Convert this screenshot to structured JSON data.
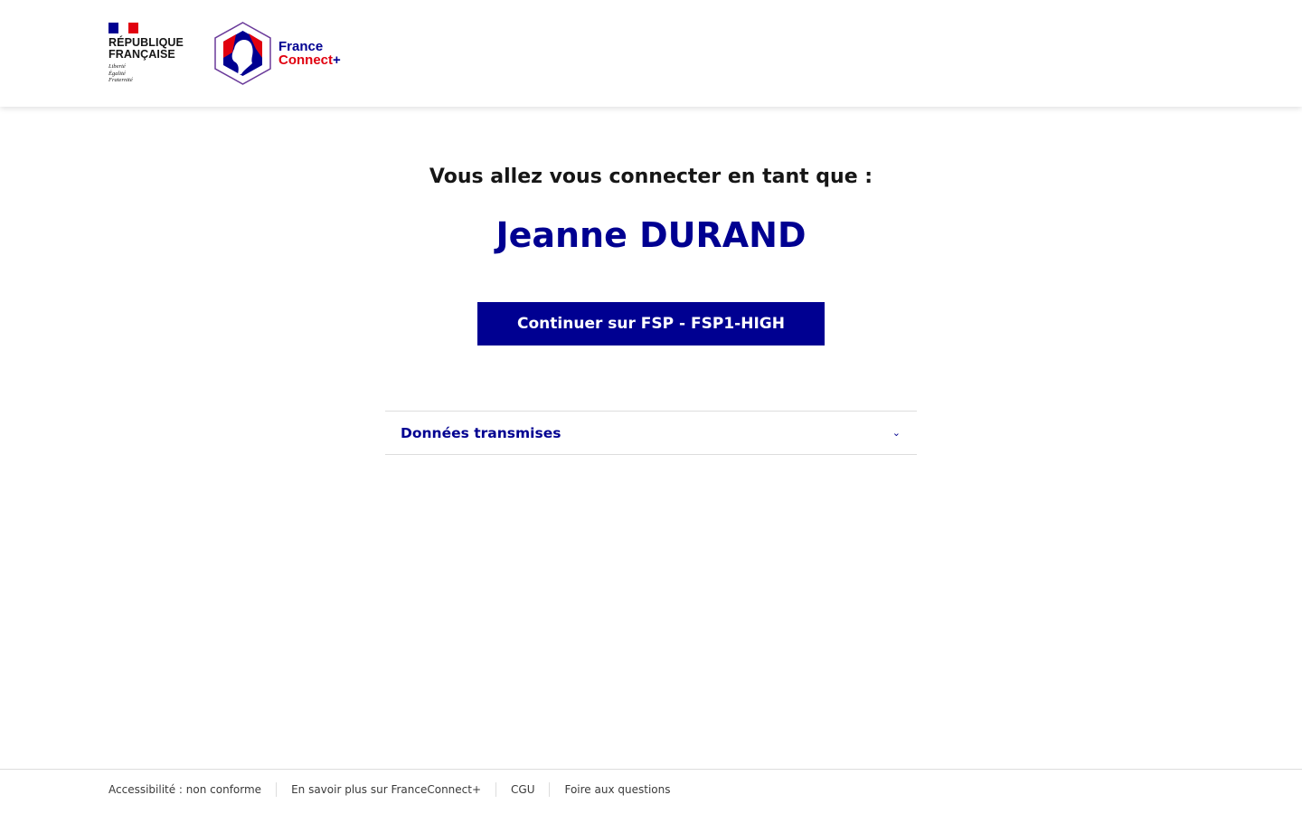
{
  "header": {
    "gov_logo": {
      "line1": "RÉPUBLIQUE",
      "line2": "FRANÇAISE",
      "motto": [
        "Liberté",
        "Égalité",
        "Fraternité"
      ]
    },
    "fc_logo": {
      "line1": "France",
      "line2": "Connect",
      "plus": "+"
    }
  },
  "main": {
    "heading": "Vous allez vous connecter en tant que :",
    "user_name": "Jeanne DURAND",
    "continue_button": "Continuer sur FSP - FSP1-HIGH",
    "accordion_label": "Données transmises"
  },
  "footer": {
    "links": [
      "Accessibilité : non conforme",
      "En savoir plus sur FranceConnect+",
      "CGU",
      "Foire aux questions"
    ]
  },
  "colors": {
    "primary": "#000091",
    "red": "#e1000f"
  }
}
